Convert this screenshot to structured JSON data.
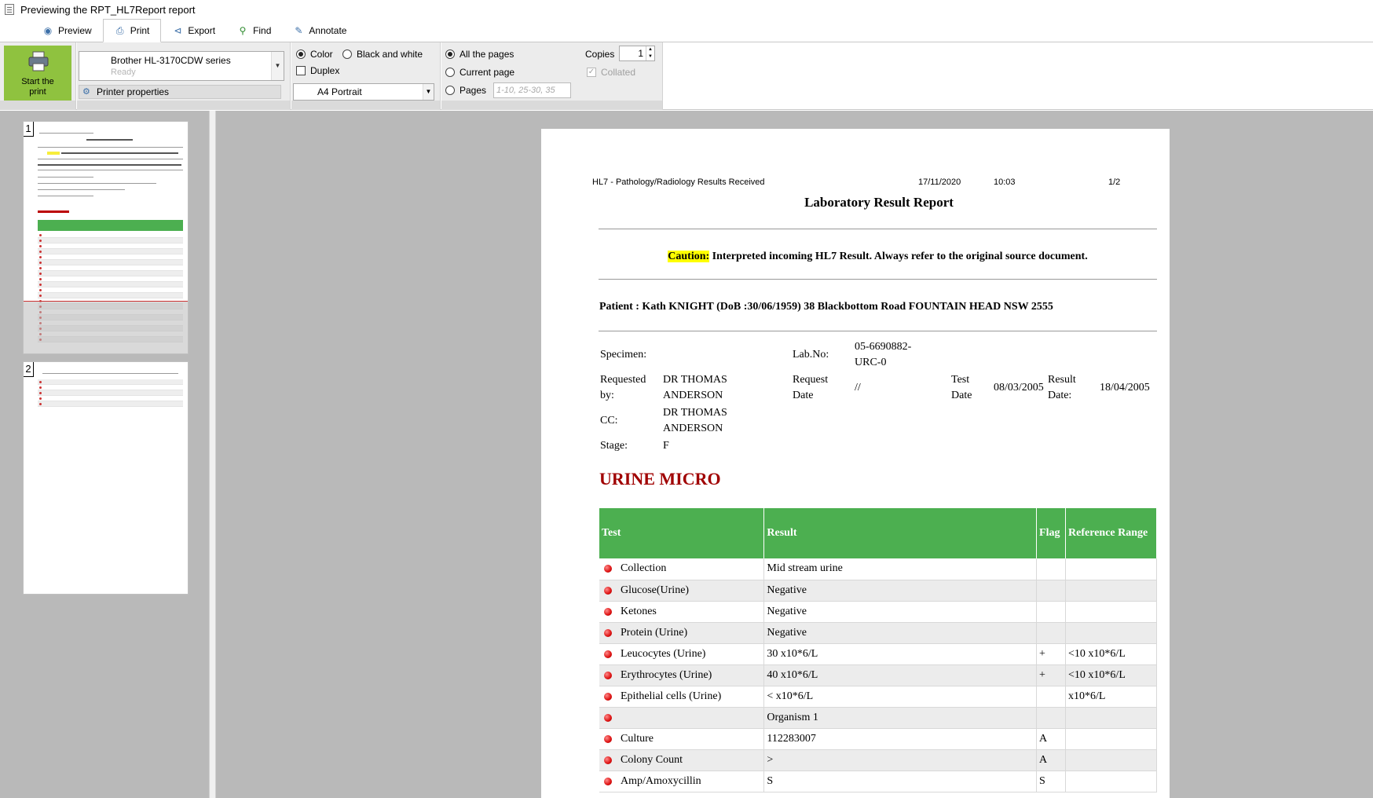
{
  "window": {
    "title": "Previewing the RPT_HL7Report report"
  },
  "tabs": [
    {
      "label": "Preview",
      "icon": "eye-icon"
    },
    {
      "label": "Print",
      "icon": "printer-icon"
    },
    {
      "label": "Export",
      "icon": "share-icon"
    },
    {
      "label": "Find",
      "icon": "search-icon"
    },
    {
      "label": "Annotate",
      "icon": "pen-icon"
    }
  ],
  "ribbon": {
    "start_print": "Start the print",
    "printer_name": "Brother HL-3170CDW series",
    "printer_status": "Ready",
    "printer_properties": "Printer properties",
    "color_label": "Color",
    "bw_label": "Black and white",
    "duplex_label": "Duplex",
    "paper": "A4 Portrait",
    "all_pages": "All the pages",
    "current_page": "Current page",
    "pages_label": "Pages",
    "pages_placeholder": "1-10, 25-30, 35",
    "copies_label": "Copies",
    "copies_value": "1",
    "collated_label": "Collated"
  },
  "thumbnails": {
    "page1": "1",
    "page2": "2"
  },
  "report": {
    "header_left": "HL7 - Pathology/Radiology Results Received",
    "header_date": "17/11/2020",
    "header_time": "10:03",
    "header_page": "1/2",
    "title": "Laboratory Result Report",
    "caution_label": "Caution:",
    "caution_text": " Interpreted incoming HL7 Result. Always refer to the original source document.",
    "patient": "Patient : Kath KNIGHT (DoB :30/06/1959) 38 Blackbottom Road FOUNTAIN HEAD NSW 2555",
    "specimen_label": "Specimen:",
    "lab_no_label": "Lab.No:",
    "lab_no_value": "05-6690882-URC-0",
    "requested_by_label": "Requested by:",
    "requested_by_value": "DR THOMAS ANDERSON",
    "request_date_label": "Request Date",
    "request_date_value": "//",
    "test_date_label": "Test Date",
    "test_date_value": "08/03/2005",
    "result_date_label": "Result Date:",
    "result_date_value": "18/04/2005",
    "cc_label": "CC:",
    "cc_value": "DR THOMAS ANDERSON",
    "stage_label": "Stage:",
    "stage_value": "F",
    "section": "URINE MICRO",
    "columns": {
      "test": "Test",
      "result": "Result",
      "flag": "Flag",
      "range": "Reference Range"
    },
    "rows": [
      {
        "test": "Collection",
        "result": "Mid stream urine",
        "flag": "",
        "range": ""
      },
      {
        "test": "Glucose(Urine)",
        "result": "Negative",
        "flag": "",
        "range": ""
      },
      {
        "test": "Ketones",
        "result": "Negative",
        "flag": "",
        "range": ""
      },
      {
        "test": "Protein (Urine)",
        "result": "Negative",
        "flag": "",
        "range": ""
      },
      {
        "test": "Leucocytes (Urine)",
        "result": "30 x10*6/L",
        "flag": "+",
        "range": "<10 x10*6/L"
      },
      {
        "test": "Erythrocytes (Urine)",
        "result": "40 x10*6/L",
        "flag": "+",
        "range": "<10 x10*6/L"
      },
      {
        "test": "Epithelial cells (Urine)",
        "result": "< x10*6/L",
        "flag": "",
        "range": "x10*6/L"
      },
      {
        "test": "",
        "result": "Organism 1",
        "flag": "",
        "range": ""
      },
      {
        "test": "Culture",
        "result": "112283007",
        "flag": "A",
        "range": ""
      },
      {
        "test": "Colony Count",
        "result": ">",
        "flag": "A",
        "range": ""
      },
      {
        "test": "Amp/Amoxycillin",
        "result": "S",
        "flag": "S",
        "range": ""
      }
    ]
  }
}
